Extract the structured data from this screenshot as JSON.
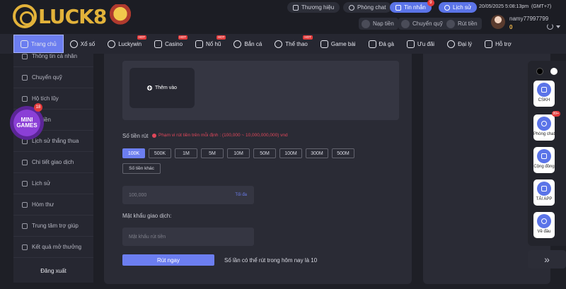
{
  "brand": {
    "logo_text": "LUCK8"
  },
  "header": {
    "pills": {
      "brand_label": "Thương hiệu",
      "chat_label": "Phòng chat",
      "messages_label": "Tin nhắn",
      "messages_badge": "9",
      "history_label": "Lịch sử"
    },
    "datetime": "20/05/2025 5:08:13pm",
    "timezone": "(GMT+7)",
    "actions": {
      "deposit": "Nạp tiền",
      "transfer": "Chuyển quỹ",
      "withdraw": "Rút tiền"
    },
    "user": {
      "name": "namy77997799",
      "balance": "0"
    }
  },
  "nav": {
    "items": [
      {
        "label": "Trang chủ",
        "icon": "home-icon",
        "hot": ""
      },
      {
        "label": "Xổ số",
        "icon": "lottery-icon",
        "hot": ""
      },
      {
        "label": "Luckywin",
        "icon": "luckywin-icon",
        "hot": "HOT"
      },
      {
        "label": "Casino",
        "icon": "casino-icon",
        "hot": "HOT"
      },
      {
        "label": "Nổ hũ",
        "icon": "slot-icon",
        "hot": "HOT"
      },
      {
        "label": "Bắn cá",
        "icon": "fish-icon",
        "hot": ""
      },
      {
        "label": "Thể thao",
        "icon": "sport-icon",
        "hot": "HOT"
      },
      {
        "label": "Game bài",
        "icon": "cards-icon",
        "hot": ""
      },
      {
        "label": "Đá gà",
        "icon": "rooster-icon",
        "hot": ""
      },
      {
        "label": "Ưu đãi",
        "icon": "gift-icon",
        "hot": ""
      },
      {
        "label": "Đại lý",
        "icon": "agent-icon",
        "hot": ""
      },
      {
        "label": "Hỗ trợ",
        "icon": "support-icon",
        "hot": ""
      }
    ]
  },
  "sidebar": {
    "items": [
      {
        "label": "Thông tin cá nhân"
      },
      {
        "label": "Chuyển quỹ"
      },
      {
        "label": "Hộ tích lũy"
      },
      {
        "label": "tiền"
      },
      {
        "label": "Lịch sử thắng thua"
      },
      {
        "label": "Chi tiết giao dịch"
      },
      {
        "label": "Lịch sử"
      },
      {
        "label": "Hòm thư"
      },
      {
        "label": "Trung tâm trợ giúp"
      },
      {
        "label": "Kết quả mở thưởng"
      }
    ],
    "logout": "Đăng xuất",
    "minigames": {
      "line1": "MINI",
      "line2": "GAMES",
      "count": "18"
    }
  },
  "withdraw": {
    "add_label": "Thêm vào",
    "amount_label": "Số tiền rút",
    "amount_hint": "Phạm vi rút tiền trên mỗi định : (100,000 ~ 10,000,000,000) vnd",
    "amounts": [
      "100K",
      "500K",
      "1M",
      "5M",
      "10M",
      "50M",
      "100M",
      "300M",
      "500M"
    ],
    "other_amount": "Số tiền khác",
    "amount_placeholder": "100,000",
    "max_label": "Tối đa",
    "password_label": "Mật khẩu giao dịch:",
    "password_placeholder": "Mật khẩu rút tiền",
    "submit_label": "Rút ngay",
    "submit_note": "Số lần có thể rút trong hôm nay là 10"
  },
  "floating": {
    "items": [
      {
        "label": "CSKH",
        "badge": ""
      },
      {
        "label": "Phòng chat",
        "badge": "99+"
      },
      {
        "label": "Cộng đồng",
        "badge": ""
      },
      {
        "label": "TẢI APP",
        "badge": ""
      },
      {
        "label": "Về đầu",
        "badge": ""
      }
    ],
    "chevron": "»"
  }
}
